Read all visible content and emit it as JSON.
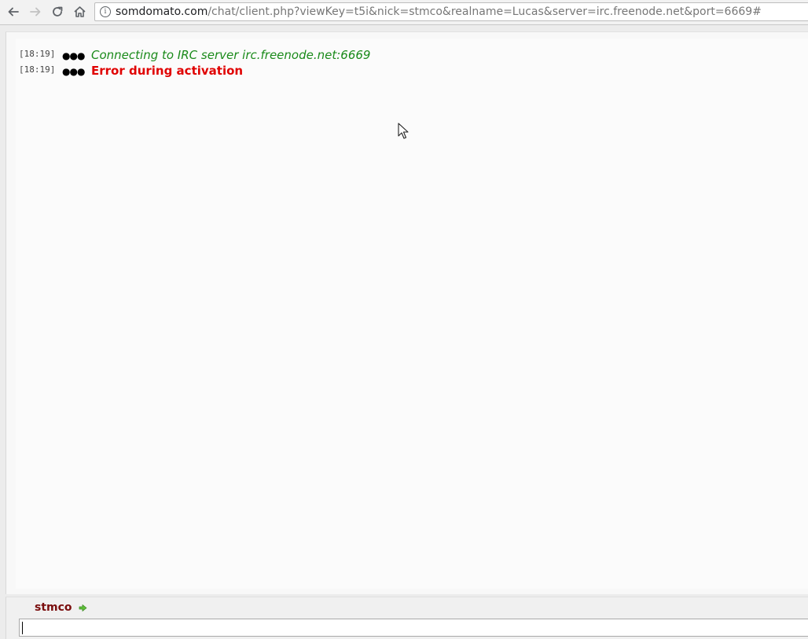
{
  "browser": {
    "url_host": "somdomato.com",
    "url_path": "/chat/client.php?viewKey=t5i&nick=stmco&realname=Lucas&server=irc.freenode.net&port=6669#",
    "info_glyph": "i",
    "icons": [
      "back-icon",
      "forward-icon",
      "reload-icon",
      "home-icon",
      "info-icon"
    ]
  },
  "log": {
    "lines": [
      {
        "time": "[18:19]",
        "marker": "●●●",
        "text": "Connecting to IRC server irc.freenode.net:6669",
        "kind": "info"
      },
      {
        "time": "[18:19]",
        "marker": "●●●",
        "text": "Error during activation",
        "kind": "error"
      }
    ]
  },
  "input_area": {
    "nick": "stmco",
    "value": "",
    "placeholder": ""
  },
  "colors": {
    "info_text": "#1a8a1a",
    "error_text": "#e00000",
    "nick": "#7a0e0e",
    "arrow": "#4caf2a"
  }
}
